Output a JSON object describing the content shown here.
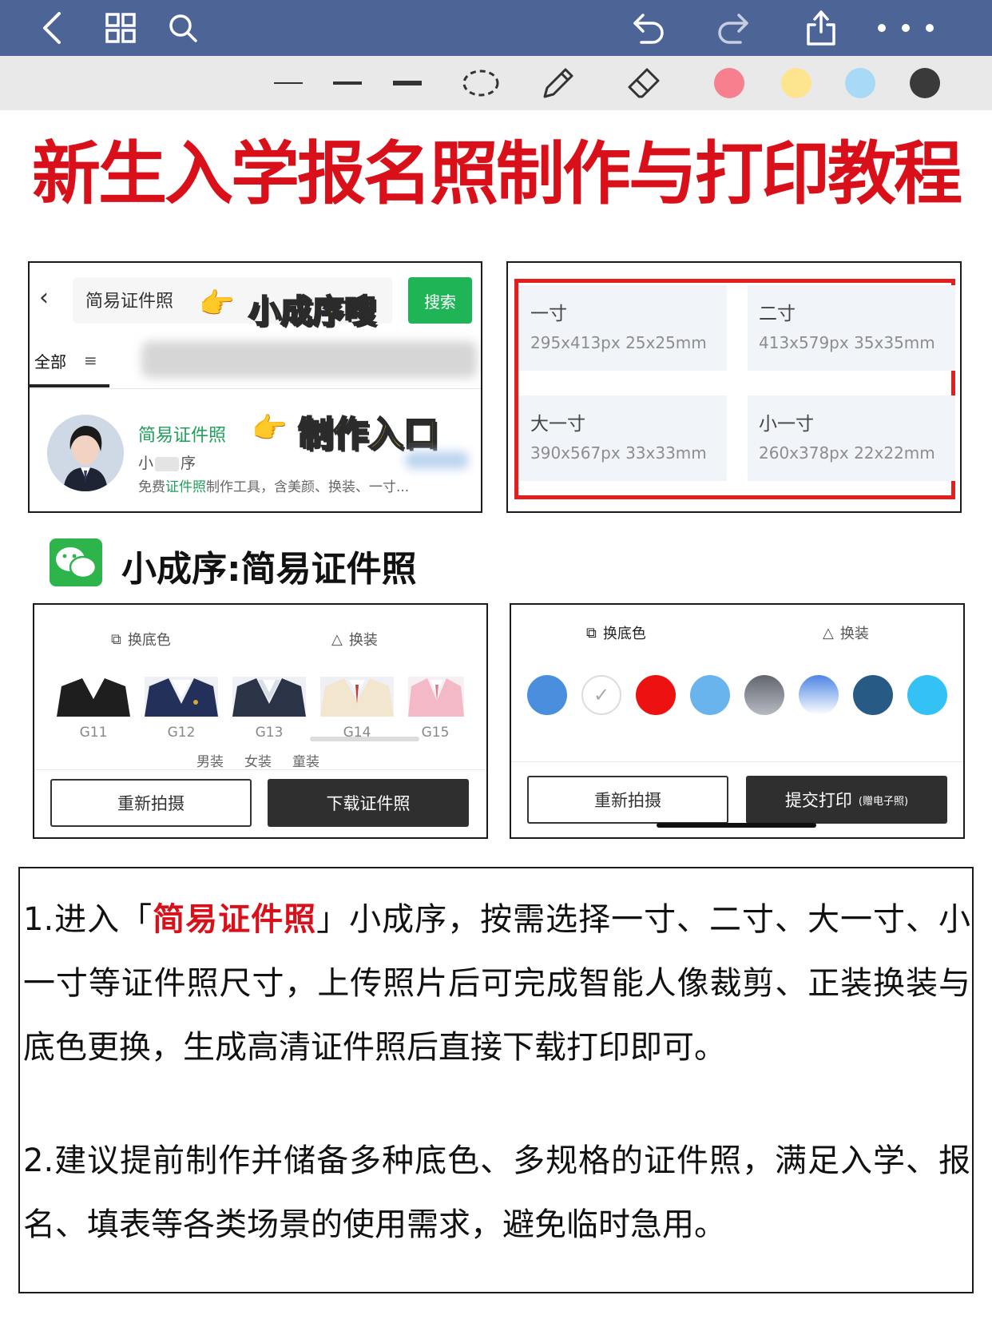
{
  "topbar": {
    "icons": [
      "back-icon",
      "grid-icon",
      "search-icon",
      "undo-icon",
      "redo-icon",
      "share-icon",
      "more-icon"
    ]
  },
  "toolbar": {
    "tools": [
      "thin-line",
      "medium-line",
      "thick-line",
      "lasso-icon",
      "pencil-icon",
      "eraser-icon"
    ],
    "colors": [
      "#f7808f",
      "#fde48f",
      "#a8daf8",
      "#3a3a3a"
    ]
  },
  "headline": "新生入学报名照制作与打印教程",
  "search_panel": {
    "query": "简易证件照",
    "search_button": "搜索",
    "callout_1": "小成序嗖",
    "tab_all": "全部",
    "result_title": "简易证件照",
    "callout_2": "制作入口",
    "result_sub_a": "小",
    "result_sub_b": "序",
    "result_desc_pre": "免费",
    "result_desc_hl": "证件照",
    "result_desc_post": "制作工具，含美颜、换装、一寸..."
  },
  "sizes_panel": {
    "items": [
      {
        "name": "一寸",
        "spec": "295x413px 25x25mm"
      },
      {
        "name": "二寸",
        "spec": "413x579px 35x35mm"
      },
      {
        "name": "大一寸",
        "spec": "390x567px 33x33mm"
      },
      {
        "name": "小一寸",
        "spec": "260x378px 22x22mm"
      }
    ]
  },
  "mini_program_label": "小成序:简易证件照",
  "outfit_panel": {
    "tab_bg": "换底色",
    "tab_outfit": "换装",
    "outfits": [
      "G11",
      "G12",
      "G13",
      "G14",
      "G15"
    ],
    "genders": [
      "男装",
      "女装",
      "童装"
    ],
    "retake": "重新拍摄",
    "download": "下载证件照"
  },
  "color_panel": {
    "tab_bg": "换底色",
    "tab_outfit": "换装",
    "swatches": [
      "#4a8fdd",
      "#ffffff",
      "#ee1111",
      "#6ab4ee",
      "#868a96",
      "#8ab4f0",
      "#285a86",
      "#34c1f6"
    ],
    "retake": "重新拍摄",
    "submit": "提交打印",
    "submit_note": "(赠电子照)"
  },
  "instructions": {
    "p1_pre": "1.进入「",
    "p1_hl": "简易证件照",
    "p1_post": "」小成序，按需选择一寸、二寸、大一寸、小一寸等证件照尺寸，上传照片后可完成智能人像裁剪、正装换装与底色更换，生成高清证件照后直接下载打印即可。",
    "p2": "2.建议提前制作并储备多种底色、多规格的证件照，满足入学、报名、填表等各类场景的使用需求，避免临时急用。"
  }
}
